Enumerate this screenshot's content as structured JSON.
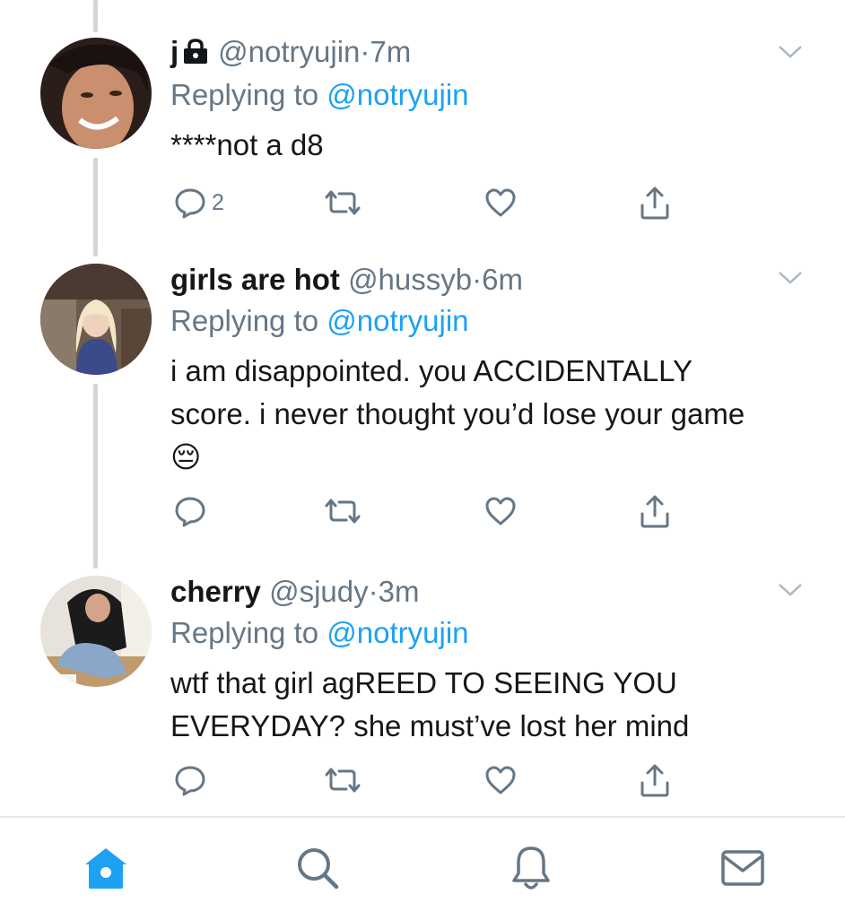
{
  "tweets": [
    {
      "name": "j",
      "handle": "@notryujin",
      "time": "7m",
      "replying_prefix": "Replying to",
      "replying_to": "@notryujin",
      "text": "****not a d8",
      "reply_count": "2",
      "locked": true
    },
    {
      "name": "girls are hot",
      "handle": "@hussyb",
      "time": "6m",
      "replying_prefix": "Replying to",
      "replying_to": "@notryujin",
      "text": "i am disappointed. you ACCIDENTALLY score. i never thought you’d lose your game 😔",
      "reply_count": ""
    },
    {
      "name": "cherry",
      "handle": "@sjudy",
      "time": "3m",
      "replying_prefix": "Replying to",
      "replying_to": "@notryujin",
      "text": "wtf that girl agREED TO SEEING YOU EVERYDAY? she must’ve lost her mind",
      "reply_count": ""
    }
  ],
  "separator": "·",
  "tabbar": {
    "items": [
      "home-icon",
      "search-icon",
      "notifications-icon",
      "messages-icon"
    ],
    "active": "home-icon"
  },
  "colors": {
    "accent": "#1da1f2",
    "secondary_text": "#657786",
    "primary_text": "#14171a",
    "thread_line": "#ccd6dd",
    "icon_gray": "#657786"
  }
}
